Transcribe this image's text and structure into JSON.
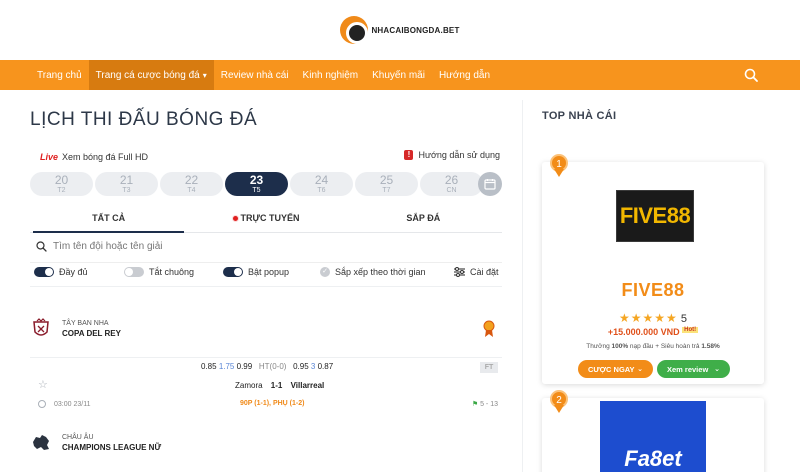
{
  "header": {
    "logo_text": "NHACAIBONGDA.BET"
  },
  "nav": {
    "items": [
      {
        "label": "Trang chủ"
      },
      {
        "label": "Trang cá cược bóng đá"
      },
      {
        "label": "Review nhà cái"
      },
      {
        "label": "Kinh nghiệm"
      },
      {
        "label": "Khuyến mãi"
      },
      {
        "label": "Hướng dẫn"
      }
    ]
  },
  "main": {
    "title": "LỊCH THI ĐẤU BÓNG ĐÁ",
    "live_tag": "Live",
    "live_text": "Xem bóng đá Full HD",
    "guide_text": "Hướng dẫn sử dụng",
    "dates": [
      {
        "day": "20",
        "weekday": "T2"
      },
      {
        "day": "21",
        "weekday": "T3"
      },
      {
        "day": "22",
        "weekday": "T4"
      },
      {
        "day": "23",
        "weekday": "T5"
      },
      {
        "day": "24",
        "weekday": "T6"
      },
      {
        "day": "25",
        "weekday": "T7"
      },
      {
        "day": "26",
        "weekday": "CN"
      }
    ],
    "tabs": {
      "all": "TẤT CẢ",
      "live": "TRỰC TUYẾN",
      "upcoming": "SẮP ĐÁ"
    },
    "search_placeholder": "Tìm tên đội hoặc tên giải",
    "options": {
      "full": "Đầy đủ",
      "sound_off": "Tắt chuông",
      "popup_on": "Bật popup",
      "sort_time": "Sắp xếp theo thời gian",
      "settings": "Cài đặt"
    }
  },
  "leagues": [
    {
      "country": "TÂY BAN NHA",
      "name": "COPA DEL REY",
      "match": {
        "odds_home": "0.85",
        "handicap": "1.75",
        "odds_away": "0.99",
        "ht": "HT(0-0)",
        "ou_over": "0.95",
        "ou_line": "3",
        "ou_under": "0.87",
        "status": "FT",
        "home": "Zamora",
        "score": "1-1",
        "away": "Villarreal",
        "time": "03:00 23/11",
        "result": "90P (1-1), PHỤ (1-2)",
        "corners": "5 - 13"
      }
    },
    {
      "country": "CHÂU ÂU",
      "name": "CHAMPIONS LEAGUE NỮ"
    }
  ],
  "sidebar": {
    "title": "TOP NHÀ CÁI",
    "cards": [
      {
        "rank": "1",
        "logo_text": "FIVE88",
        "name": "FIVE88",
        "rating": "5",
        "stars": "★★★★★",
        "bonus": "+15.000.000 VND",
        "hot": "Hot!",
        "sub_prefix": "Thưởng ",
        "sub_bold": "100%",
        "sub_mid": " nạp đầu + Siêu hoàn trả ",
        "sub_rate": "1.58%",
        "btn_bet": "CƯỢC NGAY",
        "btn_review": "Xem review"
      },
      {
        "rank": "2",
        "logo_text": "Fa8et"
      }
    ]
  },
  "colors": {
    "nav_bg": "#f7941d",
    "accent": "#f28c18",
    "dark": "#1d2e4b",
    "live": "#e02020",
    "green": "#3fae49"
  }
}
